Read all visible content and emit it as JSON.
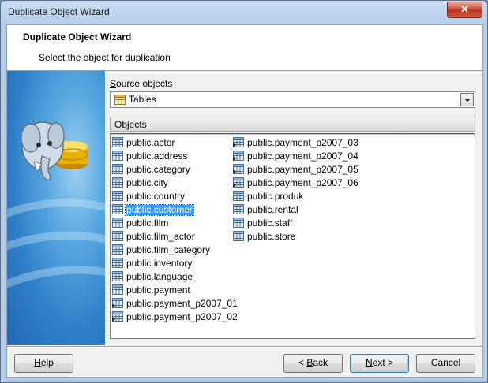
{
  "window": {
    "title": "Duplicate Object Wizard",
    "close_glyph": "✕"
  },
  "header": {
    "title": "Duplicate Object Wizard",
    "subtitle": "Select the object for duplication"
  },
  "source": {
    "label_accel": "S",
    "label_rest": "ource objects",
    "selected": "Tables",
    "icon": "table-icon"
  },
  "objects_header": "Objects",
  "objects": {
    "column1": [
      {
        "name": "public.actor",
        "icon": "table-icon"
      },
      {
        "name": "public.address",
        "icon": "table-icon"
      },
      {
        "name": "public.category",
        "icon": "table-icon"
      },
      {
        "name": "public.city",
        "icon": "table-icon"
      },
      {
        "name": "public.country",
        "icon": "table-icon"
      },
      {
        "name": "public.customer",
        "icon": "table-icon",
        "selected": true
      },
      {
        "name": "public.film",
        "icon": "table-icon"
      },
      {
        "name": "public.film_actor",
        "icon": "table-icon"
      },
      {
        "name": "public.film_category",
        "icon": "table-icon"
      },
      {
        "name": "public.inventory",
        "icon": "table-icon"
      },
      {
        "name": "public.language",
        "icon": "table-icon"
      },
      {
        "name": "public.payment",
        "icon": "table-icon"
      },
      {
        "name": "public.payment_p2007_01",
        "icon": "inherited-table-icon"
      },
      {
        "name": "public.payment_p2007_02",
        "icon": "inherited-table-icon"
      }
    ],
    "column2": [
      {
        "name": "public.payment_p2007_03",
        "icon": "inherited-table-icon"
      },
      {
        "name": "public.payment_p2007_04",
        "icon": "inherited-table-icon"
      },
      {
        "name": "public.payment_p2007_05",
        "icon": "inherited-table-icon"
      },
      {
        "name": "public.payment_p2007_06",
        "icon": "inherited-table-icon"
      },
      {
        "name": "public.produk",
        "icon": "table-icon"
      },
      {
        "name": "public.rental",
        "icon": "table-icon"
      },
      {
        "name": "public.staff",
        "icon": "table-icon"
      },
      {
        "name": "public.store",
        "icon": "table-icon"
      }
    ]
  },
  "buttons": {
    "help": {
      "accel": "H",
      "rest": "elp"
    },
    "back": {
      "prefix": "< ",
      "accel": "B",
      "rest": "ack"
    },
    "next": {
      "accel": "N",
      "rest": "ext >"
    },
    "cancel": "Cancel"
  },
  "colors": {
    "selection": "#3399ff",
    "sidepanel": "#2f7fc8"
  }
}
